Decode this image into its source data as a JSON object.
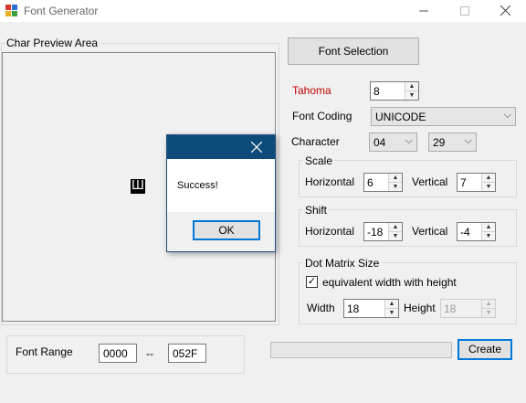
{
  "window": {
    "title": "Font Generator"
  },
  "preview": {
    "label": "Char Preview Area",
    "glyph": "Ш"
  },
  "font": {
    "selection_button": "Font Selection",
    "name": "Tahoma",
    "name_color": "#c00000",
    "size": "8",
    "coding_label": "Font Coding",
    "coding_value": "UNICODE",
    "character_label": "Character",
    "character_high": "04",
    "character_low": "29"
  },
  "scale": {
    "label": "Scale",
    "horizontal_label": "Horizontal",
    "horizontal": "6",
    "vertical_label": "Vertical",
    "vertical": "7"
  },
  "shift": {
    "label": "Shift",
    "horizontal_label": "Horizontal",
    "horizontal": "-18",
    "vertical_label": "Vertical",
    "vertical": "-4"
  },
  "dot_matrix": {
    "label": "Dot Matrix Size",
    "equiv_label": "equivalent width with height",
    "equiv_checked": true,
    "width_label": "Width",
    "width": "18",
    "height_label": "Height",
    "height": "18"
  },
  "range": {
    "label": "Font Range",
    "from": "0000",
    "separator": "--",
    "to": "052F"
  },
  "create_button": "Create",
  "progress": 0,
  "dialog": {
    "message": "Success!",
    "ok_label": "OK"
  }
}
